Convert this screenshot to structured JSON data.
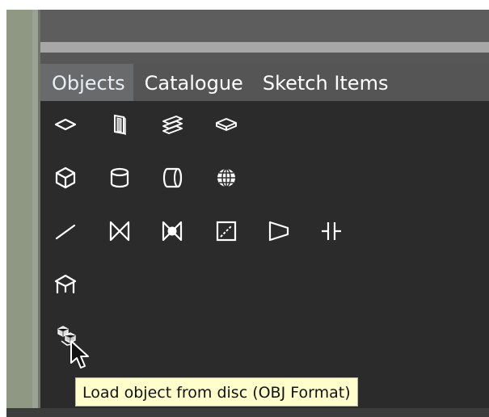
{
  "tabs": [
    {
      "label": "Objects",
      "active": true
    },
    {
      "label": "Catalogue",
      "active": false
    },
    {
      "label": "Sketch Items",
      "active": false
    }
  ],
  "icon_rows": [
    [
      "plane-icon",
      "door-icon",
      "stairs-icon",
      "box-outline-icon"
    ],
    [
      "cube-icon",
      "cylinder-icon",
      "tube-icon",
      "sphere-icon"
    ],
    [
      "line-icon",
      "butterfly-valve-icon",
      "ball-valve-icon",
      "square-diagonal-icon",
      "reducer-icon",
      "flange-icon"
    ],
    [
      "roof-icon"
    ],
    [
      "load-object-icon"
    ]
  ],
  "tooltip": {
    "text": "Load object from disc (OBJ Format)"
  },
  "colors": {
    "panel_bg": "#2b2b2b",
    "tab_bar_bg": "#555555",
    "active_tab_bg": "#686a6b",
    "tooltip_bg": "#ffffcc",
    "icon_stroke": "#ffffff"
  }
}
